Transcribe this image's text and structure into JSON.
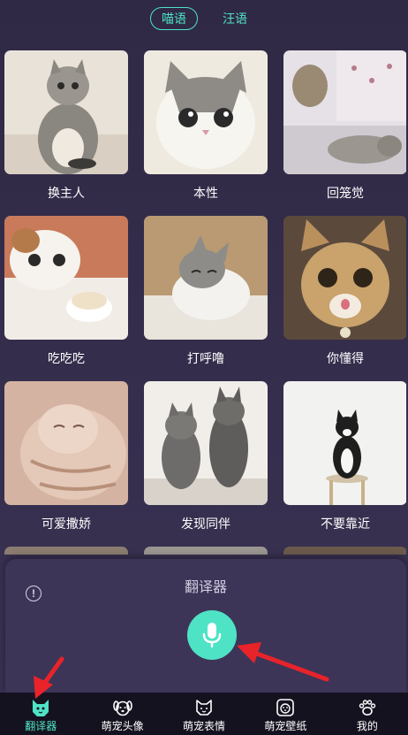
{
  "tabs": [
    {
      "label": "喵语",
      "active": true
    },
    {
      "label": "汪语",
      "active": false
    }
  ],
  "cards": [
    {
      "label": "换主人"
    },
    {
      "label": "本性"
    },
    {
      "label": "回笼觉"
    },
    {
      "label": "吃吃吃"
    },
    {
      "label": "打呼噜"
    },
    {
      "label": "你懂得"
    },
    {
      "label": "可爱撒娇"
    },
    {
      "label": "发现同伴"
    },
    {
      "label": "不要靠近"
    }
  ],
  "translator": {
    "title": "翻译器",
    "info_icon": "info-icon",
    "mic_icon": "microphone-icon"
  },
  "nav": [
    {
      "label": "翻译器",
      "icon": "cat-face-icon",
      "active": true
    },
    {
      "label": "萌宠头像",
      "icon": "dog-face-icon",
      "active": false
    },
    {
      "label": "萌宠表情",
      "icon": "cat-emoji-icon",
      "active": false
    },
    {
      "label": "萌宠壁纸",
      "icon": "dog-wallpaper-icon",
      "active": false
    },
    {
      "label": "我的",
      "icon": "paw-icon",
      "active": false
    }
  ],
  "colors": {
    "accent": "#4fe3c6",
    "background": "#37304f",
    "panel": "#3d3557",
    "nav_background": "#15121f",
    "annotation_arrow": "#e8232a"
  }
}
